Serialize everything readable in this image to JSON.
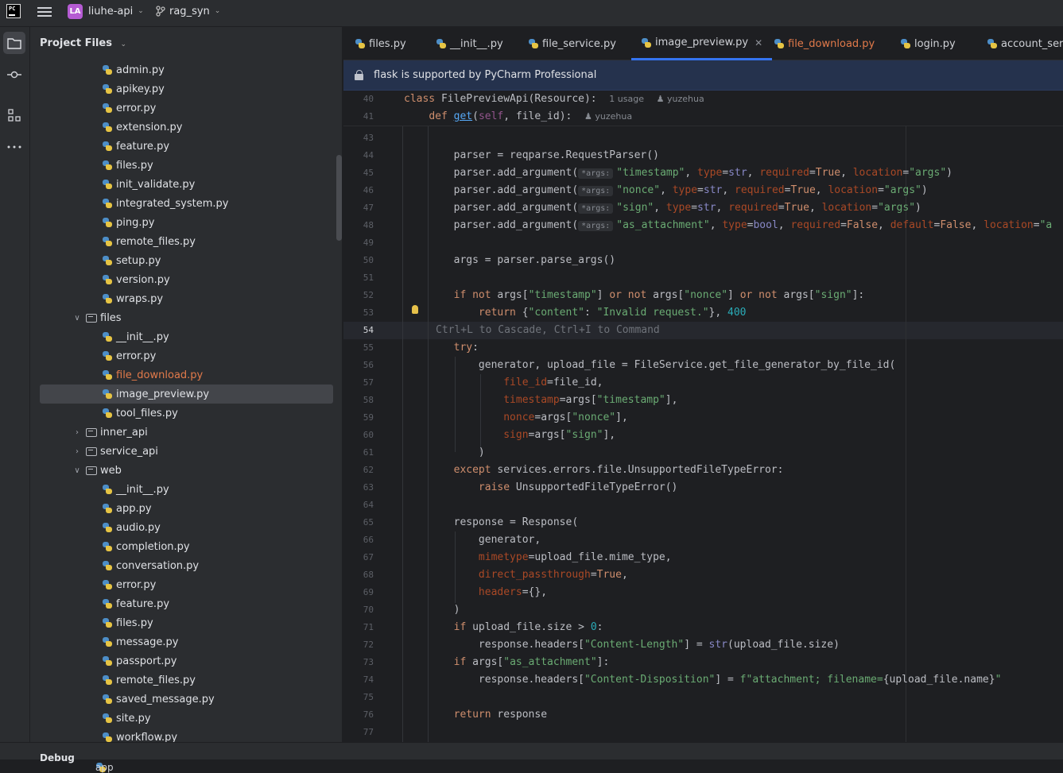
{
  "titlebar": {
    "app_icon": "PC",
    "project_badge": "LA",
    "project_name": "liuhe-api",
    "branch": "rag_syn"
  },
  "project_panel": {
    "title": "Project Files",
    "tree": [
      {
        "label": "admin.py",
        "type": "py",
        "depth": 2
      },
      {
        "label": "apikey.py",
        "type": "py",
        "depth": 2
      },
      {
        "label": "error.py",
        "type": "py",
        "depth": 2
      },
      {
        "label": "extension.py",
        "type": "py",
        "depth": 2
      },
      {
        "label": "feature.py",
        "type": "py",
        "depth": 2
      },
      {
        "label": "files.py",
        "type": "py",
        "depth": 2
      },
      {
        "label": "init_validate.py",
        "type": "py",
        "depth": 2
      },
      {
        "label": "integrated_system.py",
        "type": "py",
        "depth": 2
      },
      {
        "label": "ping.py",
        "type": "py",
        "depth": 2
      },
      {
        "label": "remote_files.py",
        "type": "py",
        "depth": 2
      },
      {
        "label": "setup.py",
        "type": "py",
        "depth": 2
      },
      {
        "label": "version.py",
        "type": "py",
        "depth": 2
      },
      {
        "label": "wraps.py",
        "type": "py",
        "depth": 2
      },
      {
        "label": "files",
        "type": "folder",
        "depth": 1,
        "expanded": true
      },
      {
        "label": "__init__.py",
        "type": "py",
        "depth": 2
      },
      {
        "label": "error.py",
        "type": "py",
        "depth": 2
      },
      {
        "label": "file_download.py",
        "type": "py",
        "depth": 2,
        "modified": true
      },
      {
        "label": "image_preview.py",
        "type": "py",
        "depth": 2,
        "selected": true
      },
      {
        "label": "tool_files.py",
        "type": "py",
        "depth": 2
      },
      {
        "label": "inner_api",
        "type": "folder",
        "depth": 1,
        "expanded": false
      },
      {
        "label": "service_api",
        "type": "folder",
        "depth": 1,
        "expanded": false
      },
      {
        "label": "web",
        "type": "folder",
        "depth": 1,
        "expanded": true
      },
      {
        "label": "__init__.py",
        "type": "py",
        "depth": 2
      },
      {
        "label": "app.py",
        "type": "py",
        "depth": 2
      },
      {
        "label": "audio.py",
        "type": "py",
        "depth": 2
      },
      {
        "label": "completion.py",
        "type": "py",
        "depth": 2
      },
      {
        "label": "conversation.py",
        "type": "py",
        "depth": 2
      },
      {
        "label": "error.py",
        "type": "py",
        "depth": 2
      },
      {
        "label": "feature.py",
        "type": "py",
        "depth": 2
      },
      {
        "label": "files.py",
        "type": "py",
        "depth": 2
      },
      {
        "label": "message.py",
        "type": "py",
        "depth": 2
      },
      {
        "label": "passport.py",
        "type": "py",
        "depth": 2
      },
      {
        "label": "remote_files.py",
        "type": "py",
        "depth": 2
      },
      {
        "label": "saved_message.py",
        "type": "py",
        "depth": 2
      },
      {
        "label": "site.py",
        "type": "py",
        "depth": 2
      },
      {
        "label": "workflow.py",
        "type": "py",
        "depth": 2
      }
    ]
  },
  "tabs": [
    {
      "label": "files.py"
    },
    {
      "label": "__init__.py"
    },
    {
      "label": "file_service.py"
    },
    {
      "label": "image_preview.py",
      "active": true
    },
    {
      "label": "file_download.py",
      "modified": true
    },
    {
      "label": "login.py"
    },
    {
      "label": "account_serv"
    }
  ],
  "banner": {
    "text": "flask is supported by PyCharm Professional"
  },
  "editor": {
    "hint_line": "Ctrl+L to Cascade, Ctrl+I to Command",
    "usage": "1 usage",
    "author": "yuzehua",
    "inlay_args": "*args:",
    "line_numbers": [
      "40",
      "41",
      "43",
      "44",
      "45",
      "46",
      "47",
      "48",
      "49",
      "50",
      "51",
      "52",
      "53",
      "54",
      "55",
      "56",
      "57",
      "58",
      "59",
      "60",
      "61",
      "62",
      "63",
      "64",
      "65",
      "66",
      "67",
      "68",
      "69",
      "70",
      "71",
      "72",
      "73",
      "74",
      "75",
      "76",
      "77"
    ]
  },
  "colors": {
    "accent": "#3574f0",
    "modified": "#e27a4a",
    "keyword": "#cf8e6d",
    "string": "#6aab73",
    "number": "#2aacb8"
  },
  "bottombar": {
    "debug": "Debug",
    "run_config": "app"
  }
}
